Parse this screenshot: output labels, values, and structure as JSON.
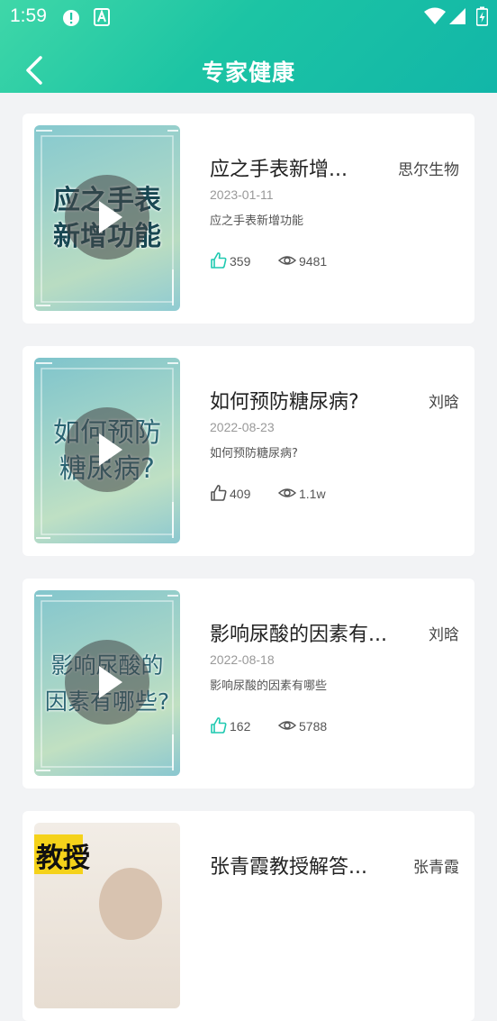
{
  "status_bar": {
    "time": "1:59"
  },
  "header": {
    "title": "专家健康"
  },
  "colors": {
    "accent": "#1dc3a6",
    "like_icon": "#1ec9b0"
  },
  "videos": [
    {
      "thumb_caption": "应之手表\n新增功能",
      "title": "应之手表新增...",
      "author": "思尔生物",
      "date": "2023-01-11",
      "description": "应之手表新增功能",
      "likes": "359",
      "views": "9481"
    },
    {
      "thumb_caption": "如何预防\n糖尿病?",
      "title": "如何预防糖尿病?",
      "author": "刘晗",
      "date": "2022-08-23",
      "description": "如何预防糖尿病?",
      "likes": "409",
      "views": "1.1w"
    },
    {
      "thumb_caption": "影响尿酸的\n因素有哪些?",
      "title": "影响尿酸的因素有...",
      "author": "刘晗",
      "date": "2022-08-18",
      "description": "影响尿酸的因素有哪些",
      "likes": "162",
      "views": "5788"
    },
    {
      "thumb_caption": "教授",
      "title": "张青霞教授解答...",
      "author": "张青霞"
    }
  ]
}
